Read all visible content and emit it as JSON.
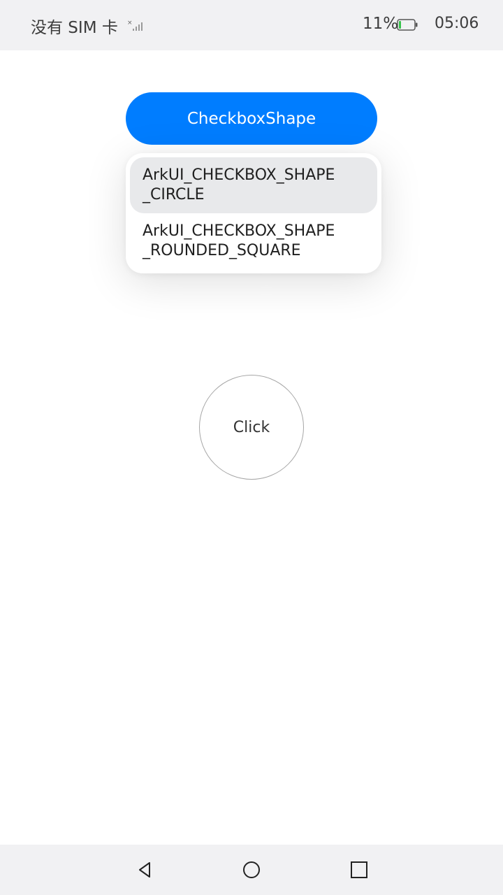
{
  "status_bar": {
    "carrier": "没有 SIM 卡",
    "battery_percent": "11%",
    "time": "05:06",
    "icons": [
      "signal-icon",
      "battery-icon"
    ]
  },
  "main": {
    "shape_button_label": "CheckboxShape",
    "menu": {
      "items": [
        {
          "label": "ArkUI_CHECKBOX_SHAPE\n_CIRCLE",
          "highlighted": true
        },
        {
          "label": "ArkUI_CHECKBOX_SHAPE\n_ROUNDED_SQUARE",
          "highlighted": false
        }
      ]
    },
    "click_button_label": "Click"
  },
  "nav_bar": {
    "icons": [
      "back-icon",
      "home-icon",
      "recents-icon"
    ]
  },
  "colors": {
    "accent": "#007dff",
    "highlight": "#e8e9eb",
    "bar_background": "#f1f1f3"
  }
}
